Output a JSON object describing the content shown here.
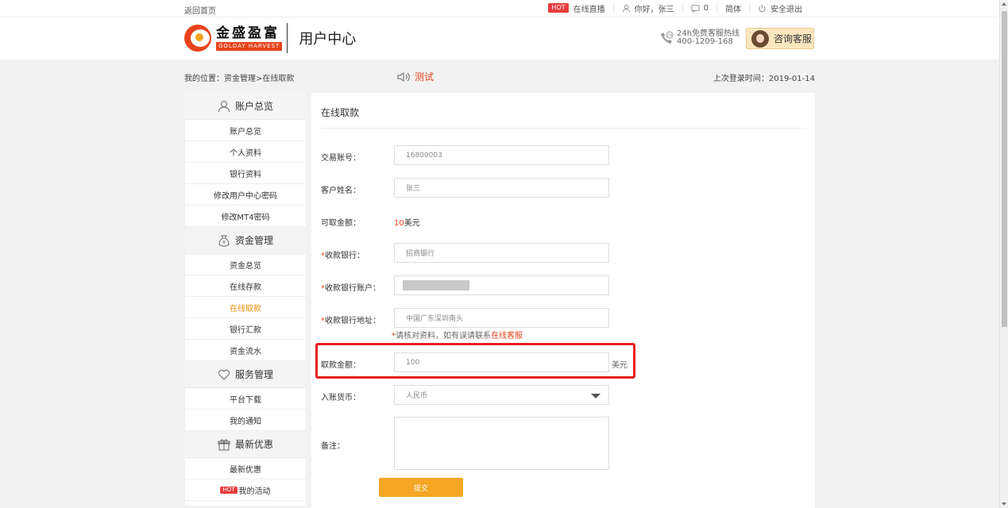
{
  "topbar": {
    "back_home": "返回首页",
    "hot_badge": "HOT",
    "live": "在线直播",
    "greeting": "你好，张三",
    "message_count": "0",
    "language": "简体",
    "logout": "安全退出"
  },
  "header": {
    "logo_cn": "金盛盈富",
    "logo_en": "GOLDAY HARVEST",
    "title": "用户中心",
    "hotline_label": "24h免费客服热线",
    "hotline_number": "400-1209-168",
    "consult_label": "咨询客服"
  },
  "infobar": {
    "breadcrumb": "我的位置：资金管理>在线取款",
    "notice": "测试",
    "last_login": "上次登录时间：2019-01-14"
  },
  "sidebar": {
    "sections": [
      {
        "title": "账户总览",
        "icon": "user-icon",
        "items": [
          "账户总览",
          "个人资料",
          "银行资料",
          "修改用户中心密码",
          "修改MT4密码"
        ]
      },
      {
        "title": "资金管理",
        "icon": "money-bag-icon",
        "items": [
          "资金总览",
          "在线存款",
          "在线取款",
          "银行汇款",
          "资金流水"
        ]
      },
      {
        "title": "服务管理",
        "icon": "heart-icon",
        "items": [
          "平台下载",
          "我的通知"
        ]
      },
      {
        "title": "最新优惠",
        "icon": "gift-icon",
        "items": [
          "最新优惠",
          "我的活动"
        ]
      }
    ],
    "active_item": "在线取款",
    "hot_tag": "HOT"
  },
  "form": {
    "title": "在线取款",
    "account_label": "交易账号：",
    "account_value": "16800003",
    "name_label": "客户姓名：",
    "name_value": "张三",
    "available_label": "可取金额：",
    "available_amount": "10",
    "available_unit": "美元",
    "bank_label": "收款银行：",
    "bank_value": "招商银行",
    "bank_account_label": "收款银行账户：",
    "bank_address_label": "收款银行地址：",
    "bank_address_value": "中国广东深圳南头",
    "hint_text": "请核对资料，如有误请联系",
    "hint_link": "在线客服",
    "amount_label": "取款金额：",
    "amount_value": "100",
    "amount_unit": "美元",
    "currency_label": "入账货币：",
    "currency_value": "人民币",
    "remark_label": "备注：",
    "submit_label": "提交"
  },
  "colors": {
    "accent": "#e8431c",
    "active": "#f0900b",
    "submit": "#f5a623",
    "highlight": "#e81e1e"
  }
}
